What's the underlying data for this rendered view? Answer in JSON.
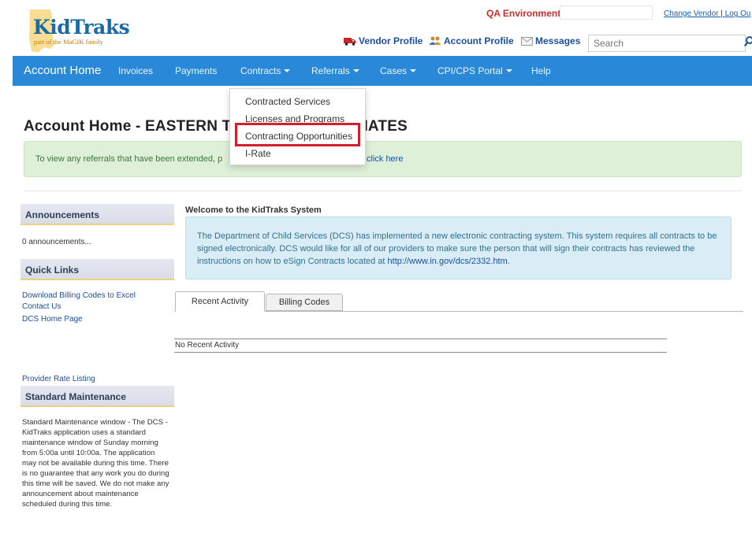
{
  "header": {
    "logo_title": "KidTraks",
    "logo_tagline": "part of the MaGIK family",
    "environment": "QA Environment",
    "environment_sep": "|",
    "change_vendor": "Change Vendor",
    "link_sep": "|",
    "logout": "Log Ou",
    "vendor_profile": "Vendor Profile",
    "account_profile": "Account Profile",
    "messages": "Messages",
    "search_placeholder": "Search"
  },
  "nav": {
    "items": [
      {
        "label": "Account Home"
      },
      {
        "label": "Invoices"
      },
      {
        "label": "Payments"
      },
      {
        "label": "Contracts"
      },
      {
        "label": "Referrals"
      },
      {
        "label": "Cases"
      },
      {
        "label": "CPI/CPS Portal"
      },
      {
        "label": "Help"
      }
    ]
  },
  "contracts_menu": {
    "items": [
      {
        "label": "Contracted Services"
      },
      {
        "label": "Licenses and Programs"
      },
      {
        "label": "Contracting Opportunities"
      },
      {
        "label": "I-Rate"
      }
    ]
  },
  "page": {
    "title_start": "Account Home - EAS",
    "title_mid": "TERN T",
    "title_end": "IATES",
    "alert_text": "To view any referrals that have been extended, p",
    "alert_link": "click here"
  },
  "sidebar": {
    "announcements_title": "Announcements",
    "announcements_text": "0 announcements...",
    "quick_links_title": "Quick Links",
    "links": [
      {
        "label": "Download Billing Codes to Excel"
      },
      {
        "label": "Contact Us"
      },
      {
        "label": "DCS Home Page"
      }
    ],
    "provider_rate": "Provider Rate Listing",
    "maintenance_title": "Standard Maintenance",
    "maintenance_text": "Standard Maintenance window - The DCS - KidTraks application uses a standard maintenance window of Sunday morning from 5:00a until 10:00a. The application may not be available during this time. There is no guarantee that any work you do during this time will be saved. We do not make any announcement about maintenance scheduled during this time."
  },
  "main": {
    "welcome_title": "Welcome to the KidTraks System",
    "welcome_text": "The Department of Child Services (DCS) has implemented a new electronic contracting system. This system requires all contracts to be signed electronically. DCS would like for all of our providers to make sure the person that will sign their contracts has reviewed the instructions on how to eSign Contracts located at ",
    "welcome_link": "http://www.in.gov/dcs/2332.htm",
    "welcome_end": ".",
    "tabs": [
      {
        "label": "Recent Activity"
      },
      {
        "label": "Billing Codes"
      }
    ],
    "no_activity": "No Recent Activity"
  },
  "colors": {
    "navbar": "#2989d8",
    "environment_red": "#d12b2b",
    "highlight_red": "#d21f2b",
    "alert_green": "#dff0d8",
    "info_blue": "#d9edf7"
  },
  "icons": [
    "indiana-map-icon",
    "truck-icon",
    "people-icon",
    "envelope-icon",
    "search-icon"
  ]
}
